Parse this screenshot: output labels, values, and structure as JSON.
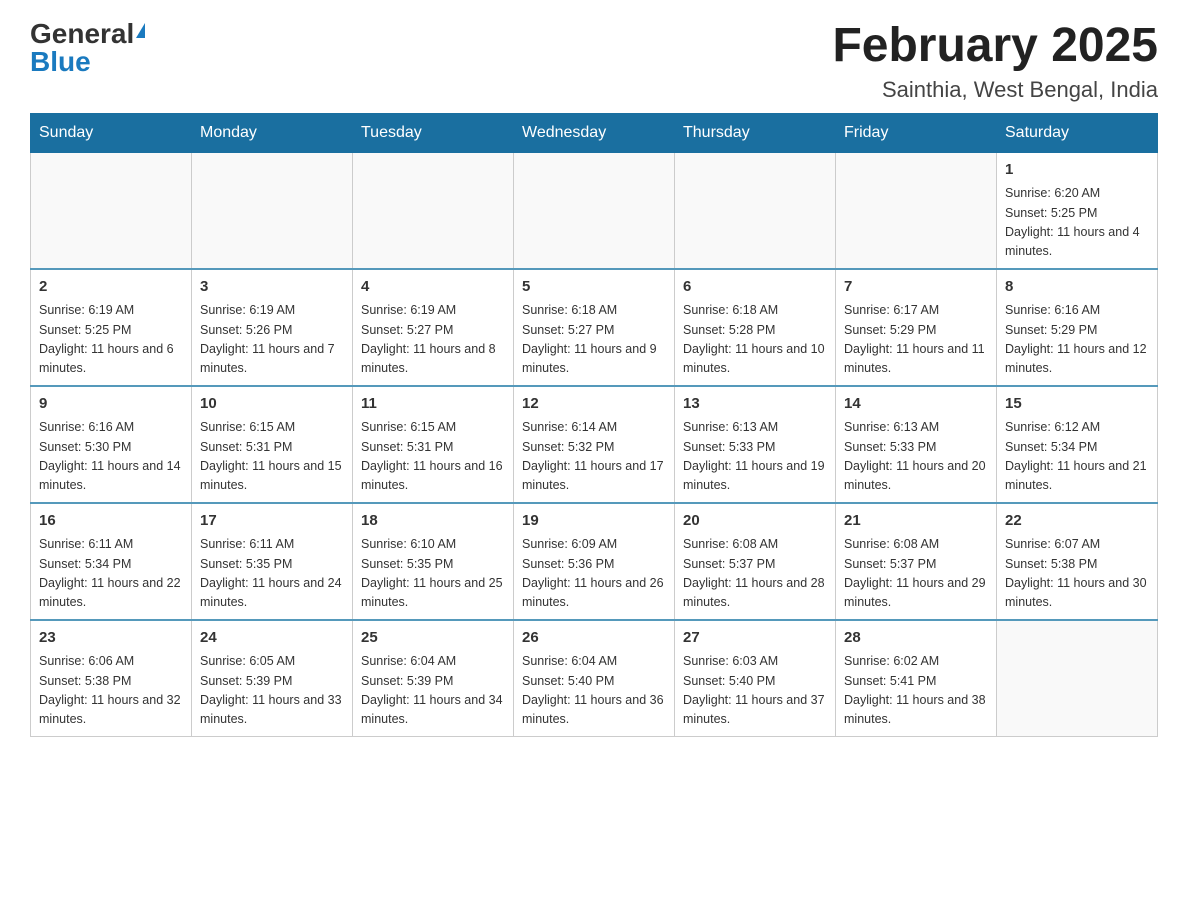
{
  "logo": {
    "general": "General",
    "blue": "Blue"
  },
  "title": "February 2025",
  "subtitle": "Sainthia, West Bengal, India",
  "weekdays": [
    "Sunday",
    "Monday",
    "Tuesday",
    "Wednesday",
    "Thursday",
    "Friday",
    "Saturday"
  ],
  "weeks": [
    [
      {
        "day": "",
        "info": ""
      },
      {
        "day": "",
        "info": ""
      },
      {
        "day": "",
        "info": ""
      },
      {
        "day": "",
        "info": ""
      },
      {
        "day": "",
        "info": ""
      },
      {
        "day": "",
        "info": ""
      },
      {
        "day": "1",
        "info": "Sunrise: 6:20 AM\nSunset: 5:25 PM\nDaylight: 11 hours and 4 minutes."
      }
    ],
    [
      {
        "day": "2",
        "info": "Sunrise: 6:19 AM\nSunset: 5:25 PM\nDaylight: 11 hours and 6 minutes."
      },
      {
        "day": "3",
        "info": "Sunrise: 6:19 AM\nSunset: 5:26 PM\nDaylight: 11 hours and 7 minutes."
      },
      {
        "day": "4",
        "info": "Sunrise: 6:19 AM\nSunset: 5:27 PM\nDaylight: 11 hours and 8 minutes."
      },
      {
        "day": "5",
        "info": "Sunrise: 6:18 AM\nSunset: 5:27 PM\nDaylight: 11 hours and 9 minutes."
      },
      {
        "day": "6",
        "info": "Sunrise: 6:18 AM\nSunset: 5:28 PM\nDaylight: 11 hours and 10 minutes."
      },
      {
        "day": "7",
        "info": "Sunrise: 6:17 AM\nSunset: 5:29 PM\nDaylight: 11 hours and 11 minutes."
      },
      {
        "day": "8",
        "info": "Sunrise: 6:16 AM\nSunset: 5:29 PM\nDaylight: 11 hours and 12 minutes."
      }
    ],
    [
      {
        "day": "9",
        "info": "Sunrise: 6:16 AM\nSunset: 5:30 PM\nDaylight: 11 hours and 14 minutes."
      },
      {
        "day": "10",
        "info": "Sunrise: 6:15 AM\nSunset: 5:31 PM\nDaylight: 11 hours and 15 minutes."
      },
      {
        "day": "11",
        "info": "Sunrise: 6:15 AM\nSunset: 5:31 PM\nDaylight: 11 hours and 16 minutes."
      },
      {
        "day": "12",
        "info": "Sunrise: 6:14 AM\nSunset: 5:32 PM\nDaylight: 11 hours and 17 minutes."
      },
      {
        "day": "13",
        "info": "Sunrise: 6:13 AM\nSunset: 5:33 PM\nDaylight: 11 hours and 19 minutes."
      },
      {
        "day": "14",
        "info": "Sunrise: 6:13 AM\nSunset: 5:33 PM\nDaylight: 11 hours and 20 minutes."
      },
      {
        "day": "15",
        "info": "Sunrise: 6:12 AM\nSunset: 5:34 PM\nDaylight: 11 hours and 21 minutes."
      }
    ],
    [
      {
        "day": "16",
        "info": "Sunrise: 6:11 AM\nSunset: 5:34 PM\nDaylight: 11 hours and 22 minutes."
      },
      {
        "day": "17",
        "info": "Sunrise: 6:11 AM\nSunset: 5:35 PM\nDaylight: 11 hours and 24 minutes."
      },
      {
        "day": "18",
        "info": "Sunrise: 6:10 AM\nSunset: 5:35 PM\nDaylight: 11 hours and 25 minutes."
      },
      {
        "day": "19",
        "info": "Sunrise: 6:09 AM\nSunset: 5:36 PM\nDaylight: 11 hours and 26 minutes."
      },
      {
        "day": "20",
        "info": "Sunrise: 6:08 AM\nSunset: 5:37 PM\nDaylight: 11 hours and 28 minutes."
      },
      {
        "day": "21",
        "info": "Sunrise: 6:08 AM\nSunset: 5:37 PM\nDaylight: 11 hours and 29 minutes."
      },
      {
        "day": "22",
        "info": "Sunrise: 6:07 AM\nSunset: 5:38 PM\nDaylight: 11 hours and 30 minutes."
      }
    ],
    [
      {
        "day": "23",
        "info": "Sunrise: 6:06 AM\nSunset: 5:38 PM\nDaylight: 11 hours and 32 minutes."
      },
      {
        "day": "24",
        "info": "Sunrise: 6:05 AM\nSunset: 5:39 PM\nDaylight: 11 hours and 33 minutes."
      },
      {
        "day": "25",
        "info": "Sunrise: 6:04 AM\nSunset: 5:39 PM\nDaylight: 11 hours and 34 minutes."
      },
      {
        "day": "26",
        "info": "Sunrise: 6:04 AM\nSunset: 5:40 PM\nDaylight: 11 hours and 36 minutes."
      },
      {
        "day": "27",
        "info": "Sunrise: 6:03 AM\nSunset: 5:40 PM\nDaylight: 11 hours and 37 minutes."
      },
      {
        "day": "28",
        "info": "Sunrise: 6:02 AM\nSunset: 5:41 PM\nDaylight: 11 hours and 38 minutes."
      },
      {
        "day": "",
        "info": ""
      }
    ]
  ]
}
